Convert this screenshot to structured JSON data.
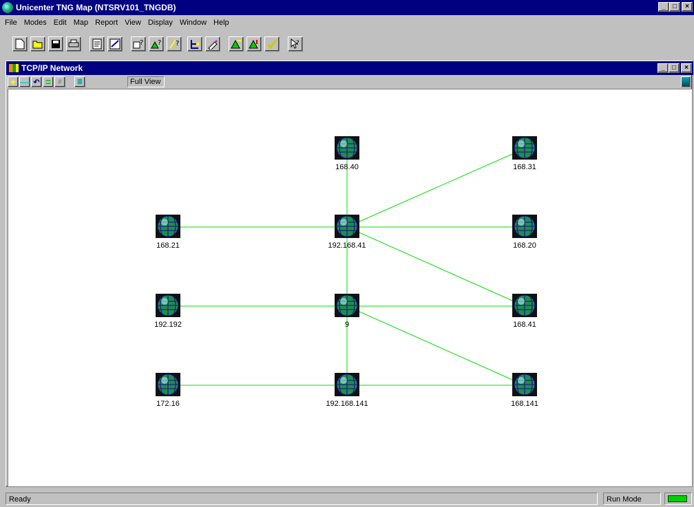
{
  "app": {
    "title": "Unicenter TNG Map (NTSRV101_TNGDB)",
    "controls": {
      "minimize": "_",
      "maximize": "□",
      "close": "×"
    }
  },
  "menu": [
    "File",
    "Modes",
    "Edit",
    "Map",
    "Report",
    "View",
    "Display",
    "Window",
    "Help"
  ],
  "toolbar_icons": [
    "new-icon",
    "open-icon",
    "save-icon",
    "print-icon",
    "properties-icon",
    "edit-icon",
    "query-class-icon",
    "query-status-icon",
    "query-line-icon",
    "tree-icon",
    "paint-icon",
    "alarm-green-icon",
    "alarm-up-icon",
    "check-icon",
    "whats-this-icon"
  ],
  "child": {
    "title": "TCP/IP Network",
    "full_view": "Full View",
    "toolbar_icons": [
      "zoom-in-icon",
      "zoom-out-icon",
      "undo-icon",
      "equal-icon",
      "grid-icon",
      "list-icon"
    ]
  },
  "network": {
    "nodes": [
      {
        "id": "n4068",
        "label": "168.40"
      },
      {
        "id": "n4031",
        "label": "168.31"
      },
      {
        "id": "n16821",
        "label": "168.21"
      },
      {
        "id": "n19216841",
        "label": "192.168.41"
      },
      {
        "id": "n16820",
        "label": "168.20"
      },
      {
        "id": "n192192",
        "label": "192.192"
      },
      {
        "id": "n9",
        "label": "9"
      },
      {
        "id": "n16841",
        "label": "168.41"
      },
      {
        "id": "n17216",
        "label": "172.16"
      },
      {
        "id": "n192168141",
        "label": "192.168.141"
      },
      {
        "id": "n168141",
        "label": "168.141"
      }
    ],
    "link_color": "#00e000"
  },
  "status": {
    "ready": "Ready",
    "mode": "Run Mode",
    "indicator_color": "#00d000"
  }
}
